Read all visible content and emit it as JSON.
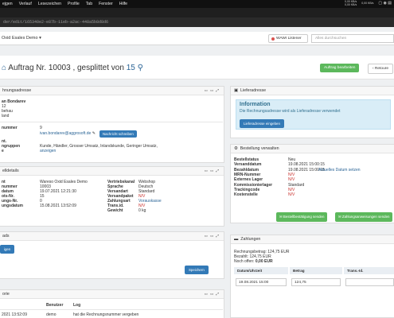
{
  "os": {
    "menu": [
      "ejgen",
      "Verlauf",
      "Lesezeichen",
      "Profile",
      "Tab",
      "Fenster",
      "Hilfe"
    ],
    "status_lines": [
      "0,00 KB/s",
      "0,00 KB/s",
      "0,00 KB/s"
    ]
  },
  "browser": {
    "url": "der/edit/165340e2-e87b-11eb-a2ac-448a5b8d8d6"
  },
  "app": {
    "shop": "Oxid Esales Demo ▾",
    "wawi": "WAWI Listener",
    "search_placeholder": "Alles durchsuchen"
  },
  "page": {
    "title_prefix": "Auftrag Nr. 10003 , gesplittet von ",
    "title_ref": "15",
    "edit_label": "Auftrag bearbeiten",
    "back_label": "‹ Retoure"
  },
  "billing": {
    "header": "hnungsadresse",
    "name": "an Bondarev",
    "line1": "12",
    "line2": "behau",
    "line3": "land",
    "mail_label": "nummer",
    "mail_num": "9",
    "email": "ivan.bondarev@aggrosoft.de",
    "msg_btn": "Nachricht schreiben",
    "groups_label1": "nt.",
    "groups_label2": "ngruppen",
    "groups_label3": "e",
    "groups": "Kunde, Händler, Grosser Umsatz, Inlandskunde, Geringer Umsatz,",
    "show_link": "anzeigen"
  },
  "details": {
    "header": "elldetails",
    "left": [
      {
        "l": "nt",
        "v": "Wareso Oxid Esales Demo"
      },
      {
        "l": "nummer",
        "v": "10003"
      },
      {
        "l": "datum",
        "v": "19.07.2021 12:21:30"
      },
      {
        "l": "ots-Nr.",
        "v": "15"
      },
      {
        "l": "ungs-Nr.",
        "v": "0"
      },
      {
        "l": "ungsdatum",
        "v": "15.08.2021 13:52:09"
      }
    ],
    "right": [
      {
        "l": "Vertriebskanal",
        "v": "Webshop",
        "c": ""
      },
      {
        "l": "Sprache",
        "v": "Deutsch",
        "c": ""
      },
      {
        "l": "Versandart",
        "v": "Standard",
        "c": ""
      },
      {
        "l": "Versandpaket",
        "v": "N/V",
        "c": "red"
      },
      {
        "l": "Zahlungsart",
        "v": "Vorauskasse",
        "c": "link"
      },
      {
        "l": "Trans.id.",
        "v": "N/V",
        "c": "red"
      },
      {
        "l": "Gewicht",
        "v": "0 kg",
        "c": ""
      }
    ]
  },
  "uploads": {
    "header": "ads",
    "add_btn": "igen",
    "save_btn": "Speichern"
  },
  "history": {
    "header": "orie",
    "cols": [
      "",
      "Benutzer",
      "Log"
    ],
    "row": {
      "date": "2021 13:52:09",
      "user": "demo",
      "log": "hat die Rechnungsnummer vergeben"
    }
  },
  "shipping_addr": {
    "header": "Lieferadresse",
    "info_title": "Information",
    "info_text": "Die Rechnungsadresse wird als Lieferadresse verwendet",
    "info_btn": "Lieferadresse eingeben"
  },
  "order_mgmt": {
    "header": "Bestellung verwalten",
    "rows": [
      {
        "l": "Bestellstatus",
        "v": "Neu",
        "x": "",
        "c": ""
      },
      {
        "l": "Versanddatum",
        "v": "19.08.2021 15:00:15",
        "x": "",
        "c": ""
      },
      {
        "l": "Bezahldatum",
        "v": "19.08.2021 15:00:15",
        "x": "Aktuelles Datum setzen",
        "c": ""
      },
      {
        "l": "MRN-Nummer",
        "v": "N/V",
        "x": "",
        "c": "red"
      },
      {
        "l": "Externes Lager",
        "v": "N/V",
        "x": "",
        "c": "red"
      },
      {
        "l": "Kommissionierlager",
        "v": "Standard",
        "x": "",
        "c": ""
      },
      {
        "l": "Trackingcode",
        "v": "N/V",
        "x": "",
        "c": "red"
      },
      {
        "l": "Kostenstelle",
        "v": "N/V",
        "x": "",
        "c": "red"
      }
    ],
    "btn1": "Bestellbestätigung senden",
    "btn2": "Zahlungsanweisungen senden"
  },
  "payments": {
    "header": "Zahlungen",
    "amount": "Rechnungsbetrag: 124,75 EUR",
    "paid": "Bezahlt: 124,75 EUR",
    "open_label": "Noch offen: ",
    "open_value": "0,00 EUR",
    "cols": [
      "Datum/Uhrzeit",
      "Betrag",
      "Trans.-Id."
    ],
    "row": {
      "date": "19.08.2021 15:00",
      "amount": "124,75"
    }
  }
}
